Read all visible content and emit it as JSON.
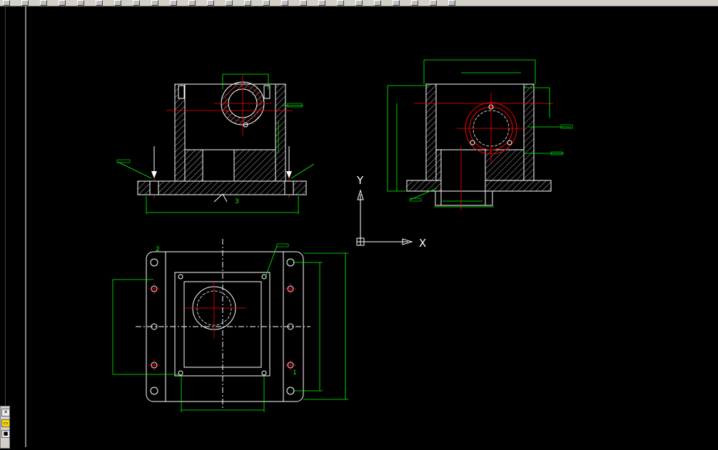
{
  "toolbar": {
    "buttons": [
      "new-icon",
      "open-icon",
      "save-icon",
      "print-icon",
      "preview-icon",
      "cut-icon",
      "copy-icon",
      "paste-icon",
      "matchprop-icon",
      "undo-icon",
      "redo-icon",
      "pan-icon",
      "zoom-icon",
      "zoomwin-icon",
      "zoomprev-icon",
      "properties-icon",
      "designcenter-icon",
      "toolpalette-icon",
      "sheetset-icon",
      "markup-icon",
      "calc-icon",
      "layer-icon",
      "layerprev-icon",
      "style-icon",
      "help-icon"
    ]
  },
  "ucs": {
    "y_label": "Y",
    "x_label": "X"
  },
  "drawing": {
    "label_front_3": "3",
    "label_plan_2": "2",
    "label_plan_1": "1"
  },
  "palette": {
    "items": [
      "✕",
      "▭",
      "■"
    ]
  },
  "colors": {
    "outline": "#ffffff",
    "dimension": "#00ff00",
    "centerline": "#ff0000",
    "hatch": "#ffffff",
    "toolbar_bg": "#d4d0c8"
  }
}
